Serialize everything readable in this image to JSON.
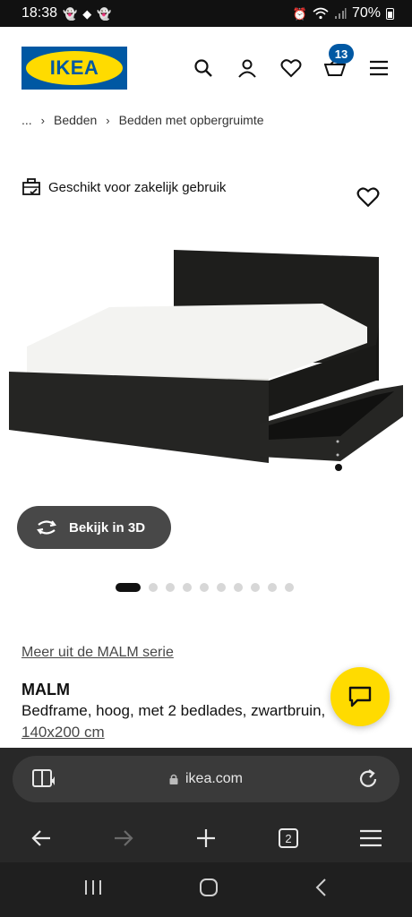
{
  "status_bar": {
    "time": "18:38",
    "battery": "70%"
  },
  "header": {
    "logo_text": "IKEA",
    "cart_count": "13"
  },
  "breadcrumb": {
    "ellipsis": "...",
    "items": [
      "Bedden",
      "Bedden met opbergruimte"
    ]
  },
  "business": {
    "label": "Geschikt voor zakelijk gebruik"
  },
  "viewer": {
    "label_3d": "Bekijk in 3D"
  },
  "carousel": {
    "total": 10,
    "active": 0
  },
  "product": {
    "series_link": "Meer uit de MALM serie",
    "name": "MALM",
    "description": "Bedframe, hoog, met 2 bedlades, zwartbruin,",
    "size": "140x200 cm"
  },
  "browser": {
    "url": "ikea.com",
    "tabs_count": "2"
  },
  "colors": {
    "ikea_blue": "#0058a3",
    "ikea_yellow": "#ffdb00"
  }
}
